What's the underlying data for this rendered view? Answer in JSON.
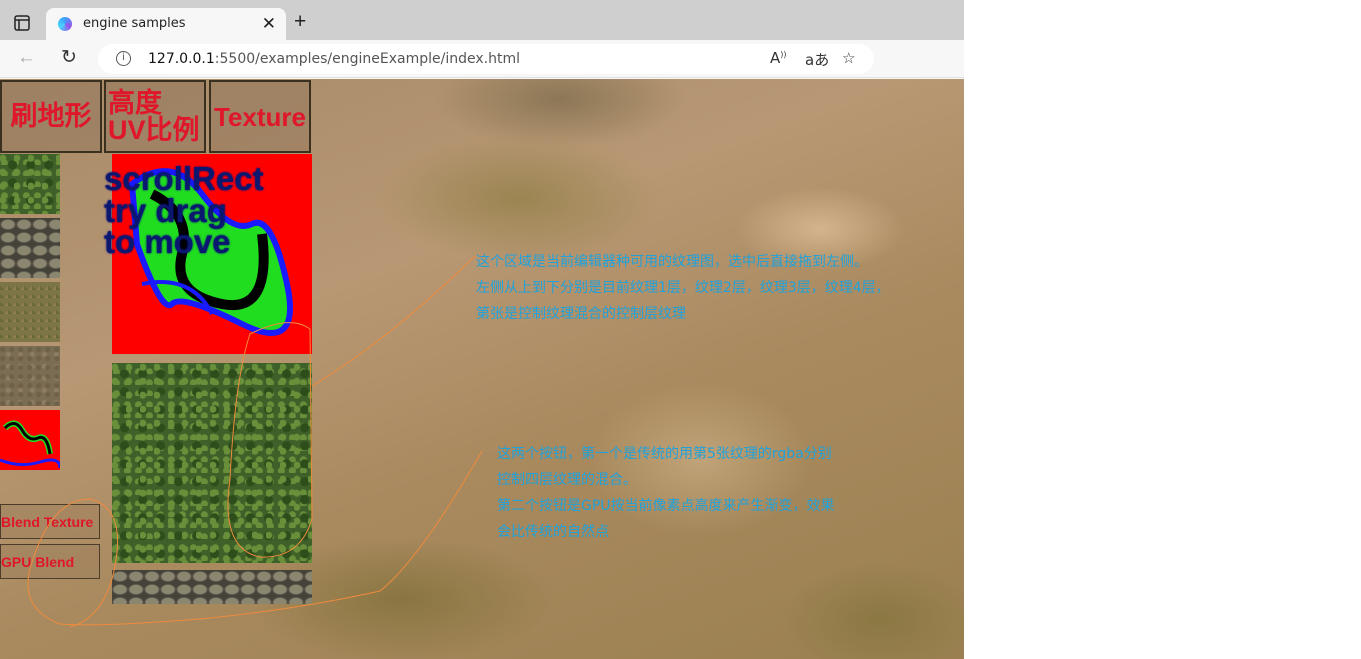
{
  "browser": {
    "tab_title": "engine samples",
    "url_host": "127.0.0.1",
    "url_rest": ":5500/examples/engineExample/index.html"
  },
  "menu": {
    "brush_terrain": "刷地形",
    "height_uv_line1": "高度",
    "height_uv_line2": "UV比例",
    "texture": "Texture"
  },
  "texture_list": [
    {
      "name": "grass"
    },
    {
      "name": "stones"
    },
    {
      "name": "moss"
    },
    {
      "name": "dirt"
    },
    {
      "name": "blend-control"
    }
  ],
  "panel": {
    "hint_line1": "scrollRect",
    "hint_line2": "try drag",
    "hint_line3": "to move"
  },
  "buttons": {
    "blend_texture": "Blend Texture",
    "gpu_blend": "GPU Blend"
  },
  "notes": {
    "texture_area": [
      "这个区域是当前编辑器种可用的纹理图，选中后直接拖到左侧。",
      "左侧从上到下分别是目前纹理1层，纹理2层，纹理3层，纹理4层，",
      "第张是控制纹理混合的控制层纹理"
    ],
    "blend_buttons": [
      "这两个按钮，第一个是传统的用第5张纹理的rgba分别",
      "控制四层纹理的混合。",
      "第二个按钮是GPU按当前像素点高度来产生渐变，效果",
      "会比传统的自然点"
    ]
  },
  "colors": {
    "button_text": "#e0162a",
    "note_text": "#21a1da",
    "annotation_line": "#f08a3c"
  }
}
